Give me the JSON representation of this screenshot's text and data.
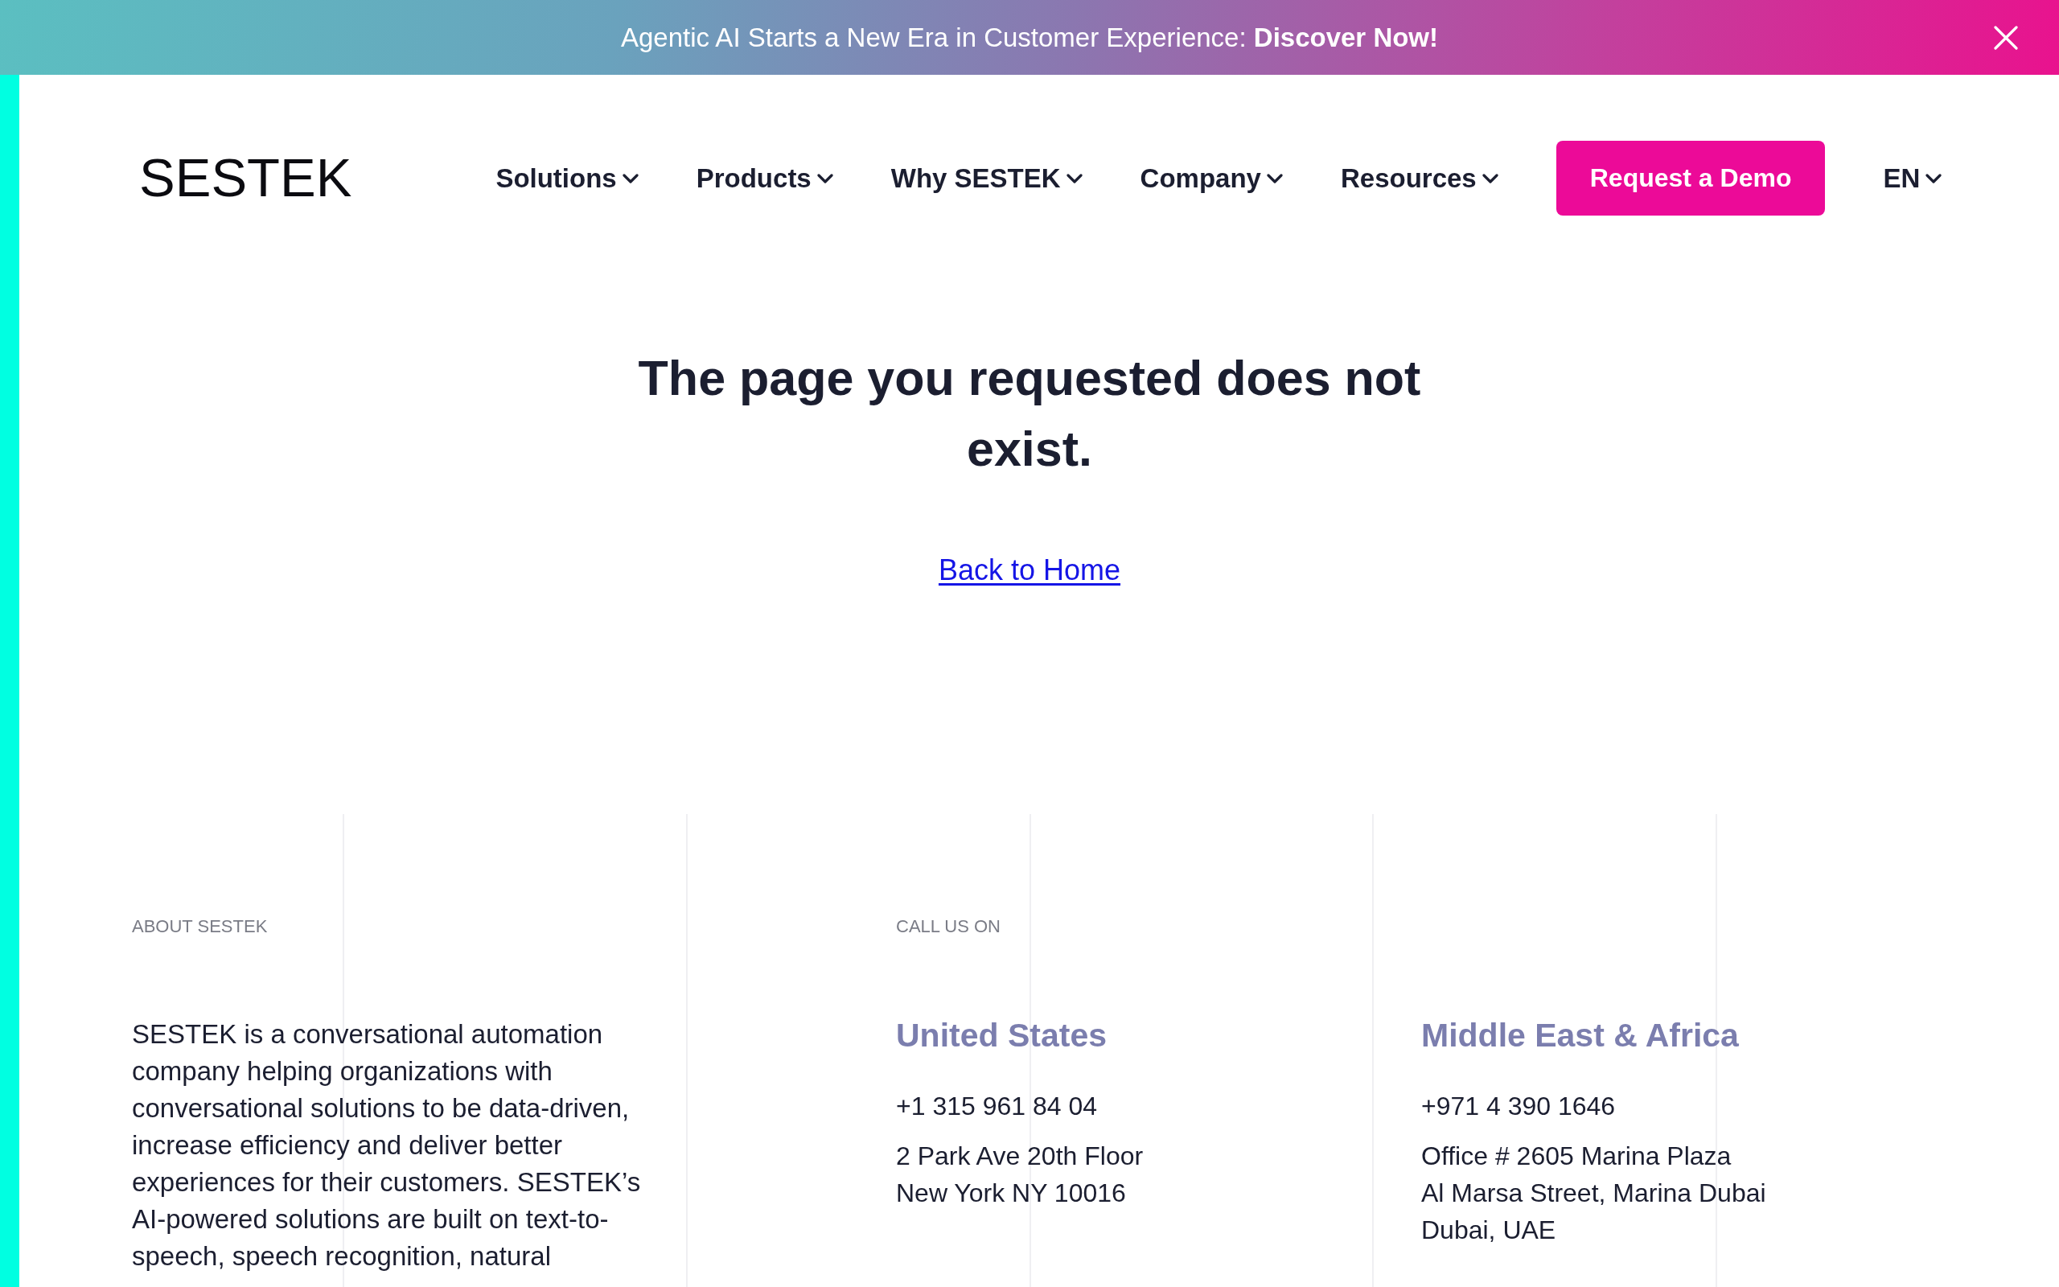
{
  "announcement_bar": {
    "text": "Agentic AI Starts a New Era in Customer Experience: **Discover Now!**"
  },
  "header": {
    "logo": "SESTEK",
    "nav": [
      "Solutions",
      "Products",
      "Why SESTEK",
      "Company",
      "Resources"
    ],
    "cta_button": "Request a Demo",
    "language": "EN"
  },
  "main": {
    "heading": "The page you requested does not exist.",
    "link": "Back to Home"
  },
  "footer": {
    "about": {
      "label": "ABOUT SESTEK",
      "text": "SESTEK is a conversational automation company helping organizations with conversational solutions to be data-driven, increase efficiency and deliver better experiences for their customers. SESTEK’s AI-powered solutions are built on text-to-speech, speech recognition, natural"
    },
    "contact": {
      "label": "CALL US ON",
      "offices": [
        {
          "region": "United States",
          "phone": "+1 315 961 84 04",
          "address": "2 Park Ave 20th Floor\nNew York NY 10016"
        },
        {
          "region": "Middle East & Africa",
          "phone": "+971 4 390 1646",
          "address": "Office # 2605 Marina Plaza\nAl Marsa Street, Marina Dubai\nDubai, UAE"
        }
      ]
    }
  }
}
